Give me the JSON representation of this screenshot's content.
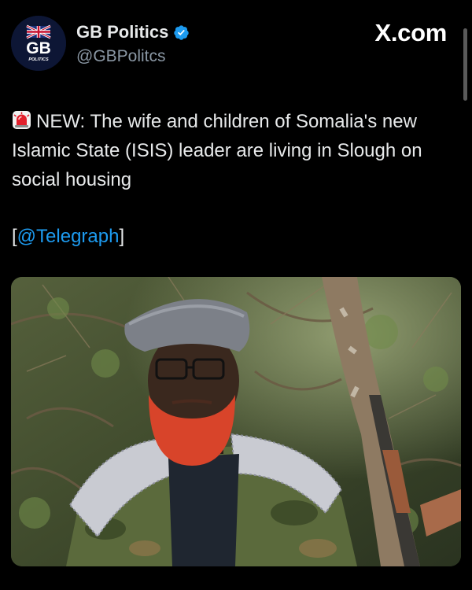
{
  "author": {
    "display_name": "GB Politics",
    "handle": "@GBPolitcs",
    "avatar_icon": "gb-politics-logo-icon",
    "avatar_text": "GB",
    "avatar_subtext": "POLITICS",
    "verified_icon": "verified-badge-icon"
  },
  "source": {
    "label": "X.com"
  },
  "tweet": {
    "emoji_icon": "rotating-light-siren-icon",
    "text": "NEW: The wife and children of Somalia's new Islamic State (ISIS) leader are living in Slough on social housing",
    "mention_open": "[",
    "mention": "@Telegraph",
    "mention_close": "]"
  },
  "media": {
    "icon": "photo-man-in-forest-with-rifle"
  },
  "colors": {
    "background": "#000000",
    "text": "#e7e9ea",
    "secondary_text": "#8b98a5",
    "link": "#1d9bf0",
    "verified": "#1d9bf0"
  }
}
